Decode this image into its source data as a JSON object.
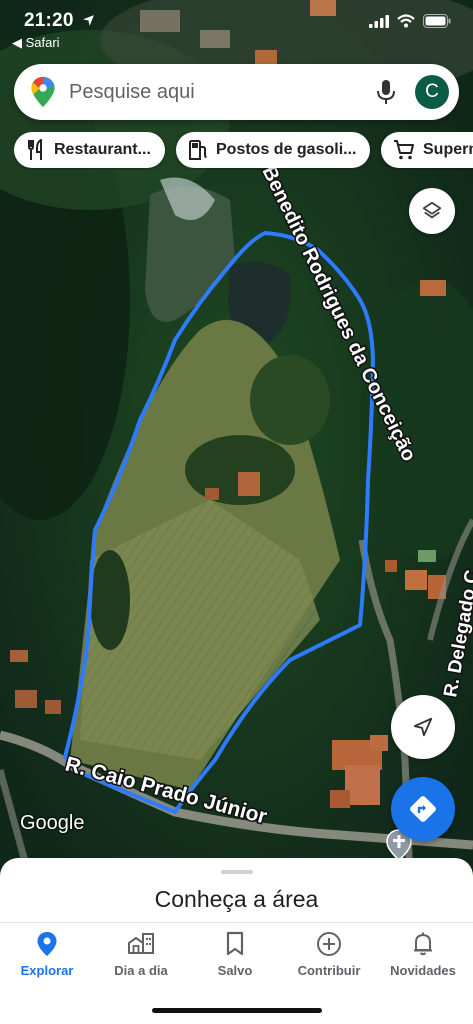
{
  "status_bar": {
    "time": "21:20",
    "back_app": "◀ Safari"
  },
  "search": {
    "placeholder": "Pesquise aqui",
    "avatar_letter": "C"
  },
  "chips": [
    {
      "icon": "restaurant-icon",
      "label": "Restaurant..."
    },
    {
      "icon": "gas-station-icon",
      "label": "Postos de gasoli..."
    },
    {
      "icon": "cart-icon",
      "label": "Superm"
    }
  ],
  "map": {
    "roads": [
      "Benedito Rodrigues da Conceição",
      "R. Delegado C",
      "R. Caio Prado Júnior"
    ],
    "watermark": "Google",
    "drawn_outline_color": "#2f7bff"
  },
  "sheet": {
    "title": "Conheça a área"
  },
  "nav": [
    {
      "icon": "explore-pin-icon",
      "label": "Explorar",
      "active": true
    },
    {
      "icon": "commute-icon",
      "label": "Dia a dia",
      "active": false
    },
    {
      "icon": "bookmark-icon",
      "label": "Salvo",
      "active": false
    },
    {
      "icon": "add-circle-icon",
      "label": "Contribuir",
      "active": false
    },
    {
      "icon": "bell-icon",
      "label": "Novidades",
      "active": false
    }
  ],
  "colors": {
    "accent": "#1a73e8",
    "avatar_bg": "#0a5c47"
  }
}
